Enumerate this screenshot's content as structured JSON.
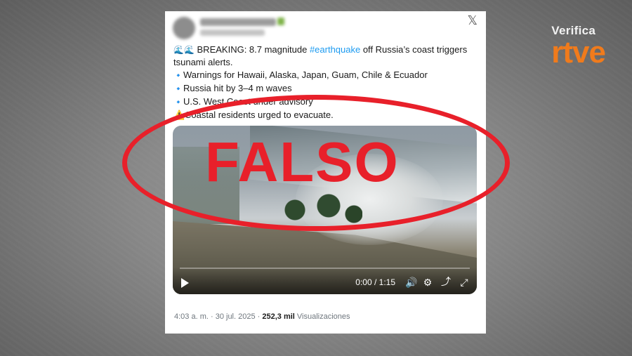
{
  "brand": {
    "name_top": "Verifica",
    "name_bottom": "rtve",
    "color": "#f07b1c"
  },
  "tweet": {
    "icons": {
      "wave": "water-wave-icon",
      "diamond": "blue-diamond-icon",
      "warning": "warning-icon"
    },
    "breaking_prefix": "BREAKING: 8.7 magnitude ",
    "hashtag": "#earthquake",
    "breaking_suffix": " off Russia’s coast triggers",
    "line2": "tsunami alerts.",
    "bullet1": "Warnings for Hawaii, Alaska, Japan, Guam, Chile & Ecuador",
    "bullet2": "Russia hit by 3–4 m waves",
    "bullet3": "U.S. West Coast under advisory",
    "warning_line": "Coastal residents urged to evacuate."
  },
  "video": {
    "time": "0:00 / 1:15",
    "progress": 0
  },
  "meta": {
    "time": "4:03 a. m.",
    "separator1": " · ",
    "date": "30 jul. 2025",
    "separator2": " · ",
    "views_count": "252,3 mil",
    "views_label": " Visualizaciones"
  },
  "stamp": {
    "text": "FALSO",
    "color": "#e8202a"
  }
}
